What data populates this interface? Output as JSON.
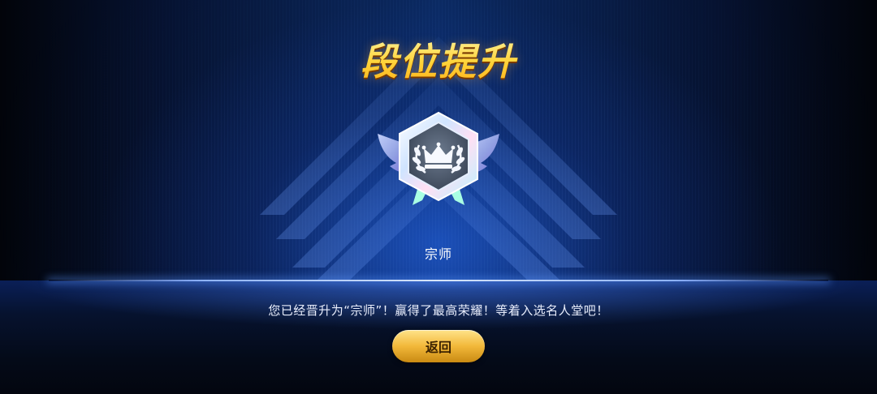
{
  "screen": {
    "title": "段位提升",
    "rank_name": "宗师",
    "message": "您已经晋升为“宗师”！赢得了最高荣耀！等着入选名人堂吧！",
    "back_button_label": "返回"
  },
  "badge": {
    "icon": "crown-laurel-hexagon-wings-icon"
  },
  "colors": {
    "title": "#ffd43a",
    "button": "#f2b83a",
    "background_glow": "#2a6eff"
  }
}
